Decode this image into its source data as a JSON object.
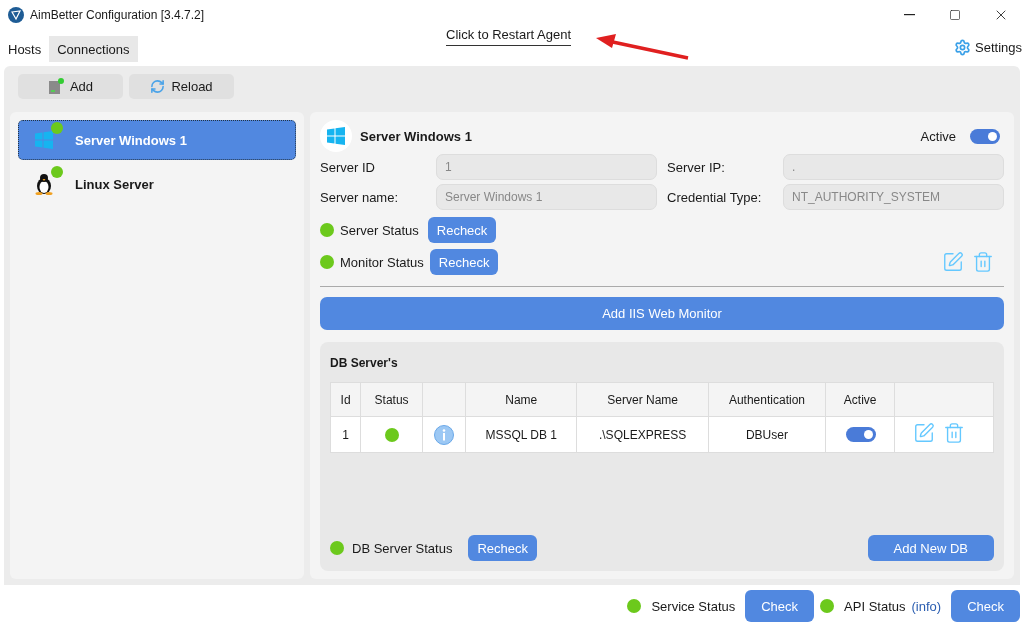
{
  "window": {
    "title": "AimBetter Configuration [3.4.7.2]"
  },
  "tabs": [
    {
      "label": "Hosts",
      "selected": true
    },
    {
      "label": "Connections",
      "selected": false
    }
  ],
  "restart_link": "Click to Restart Agent",
  "settings": "Settings",
  "toolbar": [
    {
      "label": "Add",
      "kind": "add"
    },
    {
      "label": "Reload",
      "kind": "reload"
    }
  ],
  "hosts": [
    {
      "name": "Server Windows 1",
      "kind": "windows",
      "selected": true,
      "color": "#6cc91c"
    },
    {
      "name": "Linux Server",
      "kind": "linux",
      "selected": false,
      "color": "#6cc91c"
    }
  ],
  "detail": {
    "title": "Server Windows 1",
    "kind": "windows",
    "active_label": "Active",
    "active": true,
    "fields": [
      {
        "label": "Server ID",
        "value": "1"
      },
      {
        "label": "Server IP:",
        "value": "."
      },
      {
        "label": "Server name:",
        "value": "Server Windows 1"
      },
      {
        "label": "Credential Type:",
        "value": "NT_AUTHORITY_SYSTEM"
      }
    ],
    "statuses": [
      {
        "label": "Server Status",
        "color": "#6cc91c",
        "button": "Recheck"
      },
      {
        "label": "Monitor Status",
        "color": "#6cc91c",
        "button": "Recheck"
      }
    ],
    "add_monitor": "Add IIS Web Monitor"
  },
  "db": {
    "title": "DB Server's",
    "columns": [
      {
        "kind": "text",
        "label": "Id"
      },
      {
        "kind": "text",
        "label": "Status"
      },
      {
        "kind": "blank"
      },
      {
        "kind": "text",
        "label": "Name"
      },
      {
        "kind": "text",
        "label": "Server Name"
      },
      {
        "kind": "text",
        "label": "Authentication"
      },
      {
        "kind": "text",
        "label": "Active"
      },
      {
        "kind": "blank"
      }
    ],
    "rows": [
      {
        "id": "1",
        "color": "#6cc91c",
        "name": "MSSQL DB 1",
        "server_name": ".\\SQLEXPRESS",
        "authentication": "DBUser",
        "active": true
      }
    ],
    "status": {
      "label": "DB Server Status",
      "color": "#6cc91c",
      "button": "Recheck"
    },
    "add_button": "Add New DB"
  },
  "footer": [
    {
      "label": "Service Status",
      "color": "#6cc91c",
      "button": "Check"
    },
    {
      "label": "API Status",
      "color": "#6cc91c",
      "info": "(info)",
      "button": "Check"
    }
  ]
}
